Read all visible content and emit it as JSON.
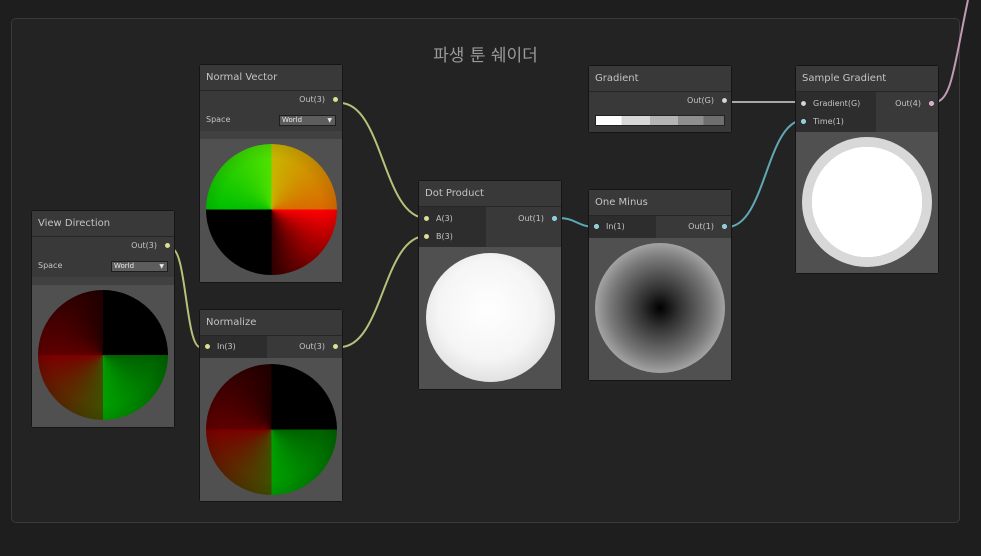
{
  "group": {
    "title": "파생 툰 쉐이더"
  },
  "nodes": {
    "normal_vector": {
      "title": "Normal Vector",
      "out": "Out(3)",
      "space_label": "Space",
      "space_value": "World"
    },
    "view_direction": {
      "title": "View Direction",
      "out": "Out(3)",
      "space_label": "Space",
      "space_value": "World"
    },
    "normalize": {
      "title": "Normalize",
      "in": "In(3)",
      "out": "Out(3)"
    },
    "dot_product": {
      "title": "Dot Product",
      "in_a": "A(3)",
      "in_b": "B(3)",
      "out": "Out(1)"
    },
    "gradient": {
      "title": "Gradient",
      "out": "Out(G)"
    },
    "one_minus": {
      "title": "One Minus",
      "in": "In(1)",
      "out": "Out(1)"
    },
    "sample_gradient": {
      "title": "Sample Gradient",
      "in_gradient": "Gradient(G)",
      "in_time": "Time(1)",
      "out": "Out(4)"
    }
  },
  "colors": {
    "wire_vector3": "#b8c17a",
    "wire_vector1": "#5fa9b6",
    "wire_gradient": "#a8a8a8",
    "wire_vector4": "#c29ab5"
  }
}
